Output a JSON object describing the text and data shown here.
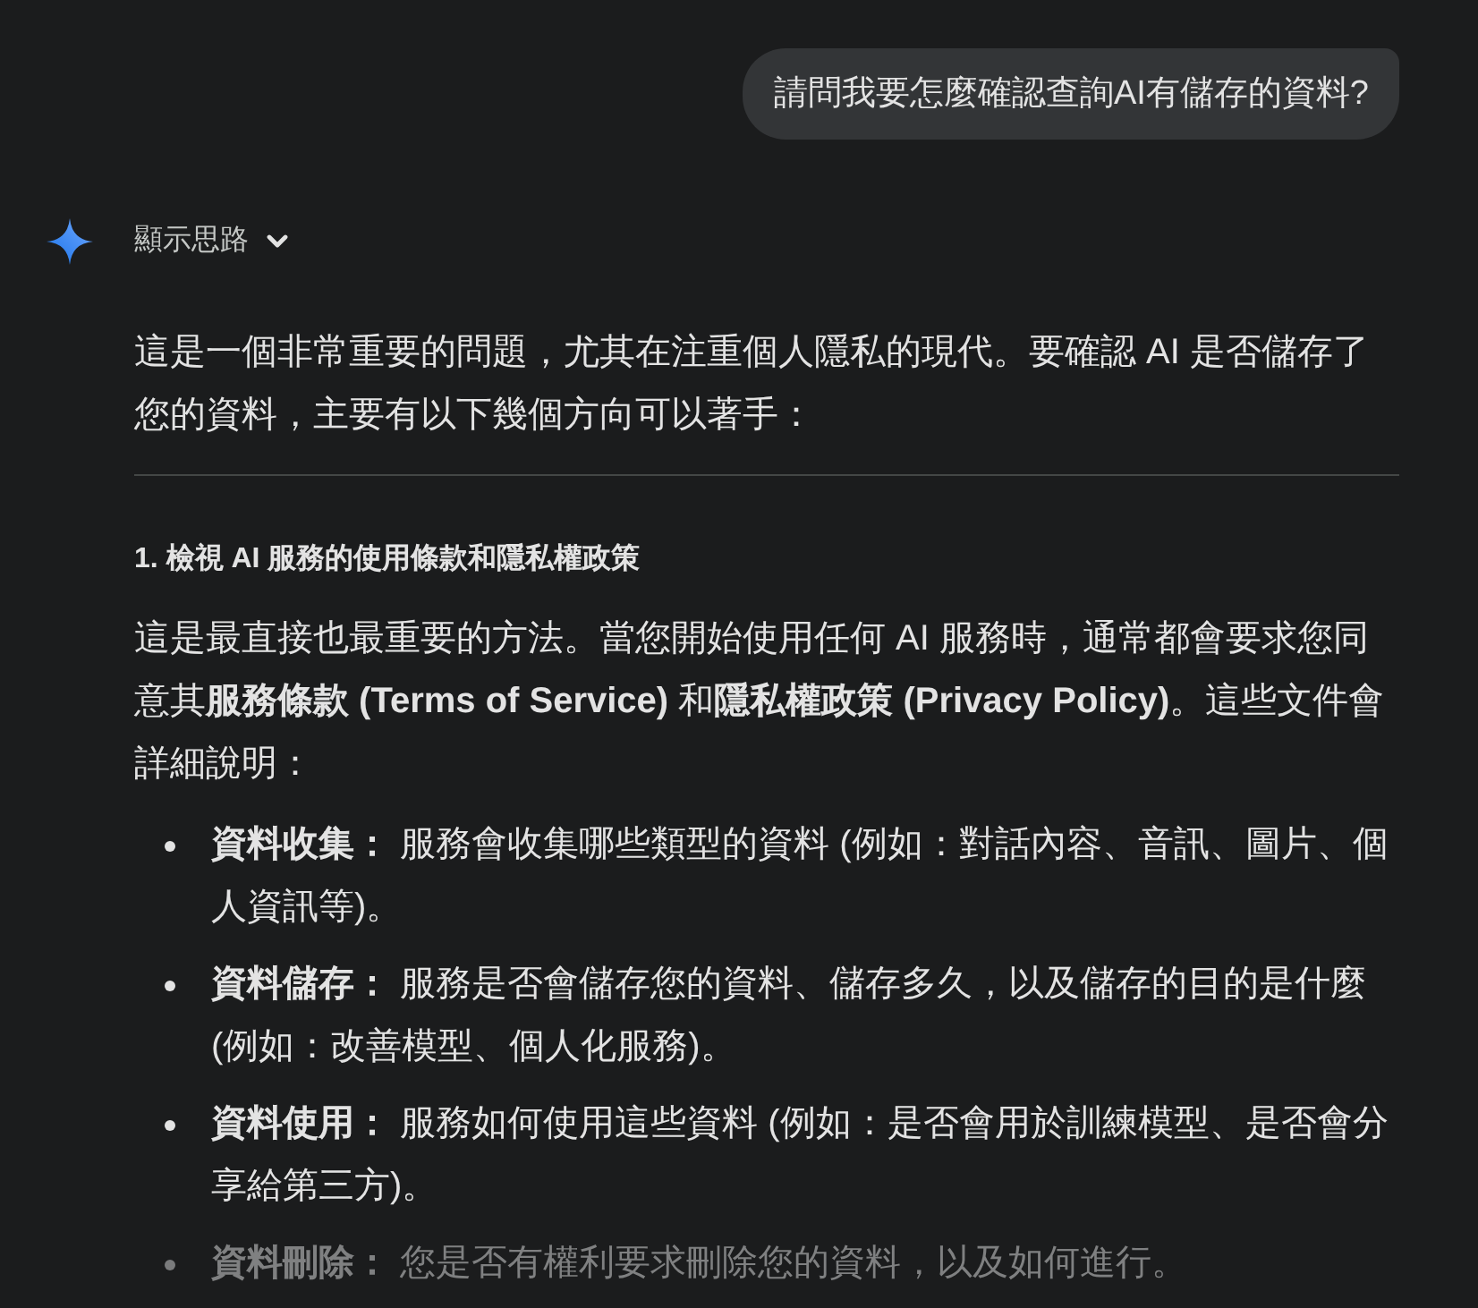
{
  "user_message": {
    "text": "請問我要怎麼確認查詢AI有儲存的資料?"
  },
  "response": {
    "thoughts_toggle": {
      "label": "顯示思路",
      "expanded": false
    },
    "intro": "這是一個非常重要的問題，尤其在注重個人隱私的現代。要確認 AI 是否儲存了您的資料，主要有以下幾個方向可以著手：",
    "sections": [
      {
        "heading": "1. 檢視 AI 服務的使用條款和隱私權政策",
        "paragraph": "這是最直接也最重要的方法。當您開始使用任何 AI 服務時，通常都會要求您同意其**服務條款 (Terms of Service)** 和**隱私權政策 (Privacy Policy)**。這些文件會詳細說明：",
        "bullets": [
          {
            "text": "**資料收集：** 服務會收集哪些類型的資料 (例如：對話內容、音訊、圖片、個人資訊等)。",
            "faded": false
          },
          {
            "text": "**資料儲存：** 服務是否會儲存您的資料、儲存多久，以及儲存的目的是什麼 (例如：改善模型、個人化服務)。",
            "faded": false
          },
          {
            "text": "**資料使用：** 服務如何使用這些資料 (例如：是否會用於訓練模型、是否會分享給第三方)。",
            "faded": false
          },
          {
            "text": "**資料刪除：** 您是否有權利要求刪除您的資料，以及如何進行。",
            "faded": true
          }
        ]
      }
    ]
  }
}
